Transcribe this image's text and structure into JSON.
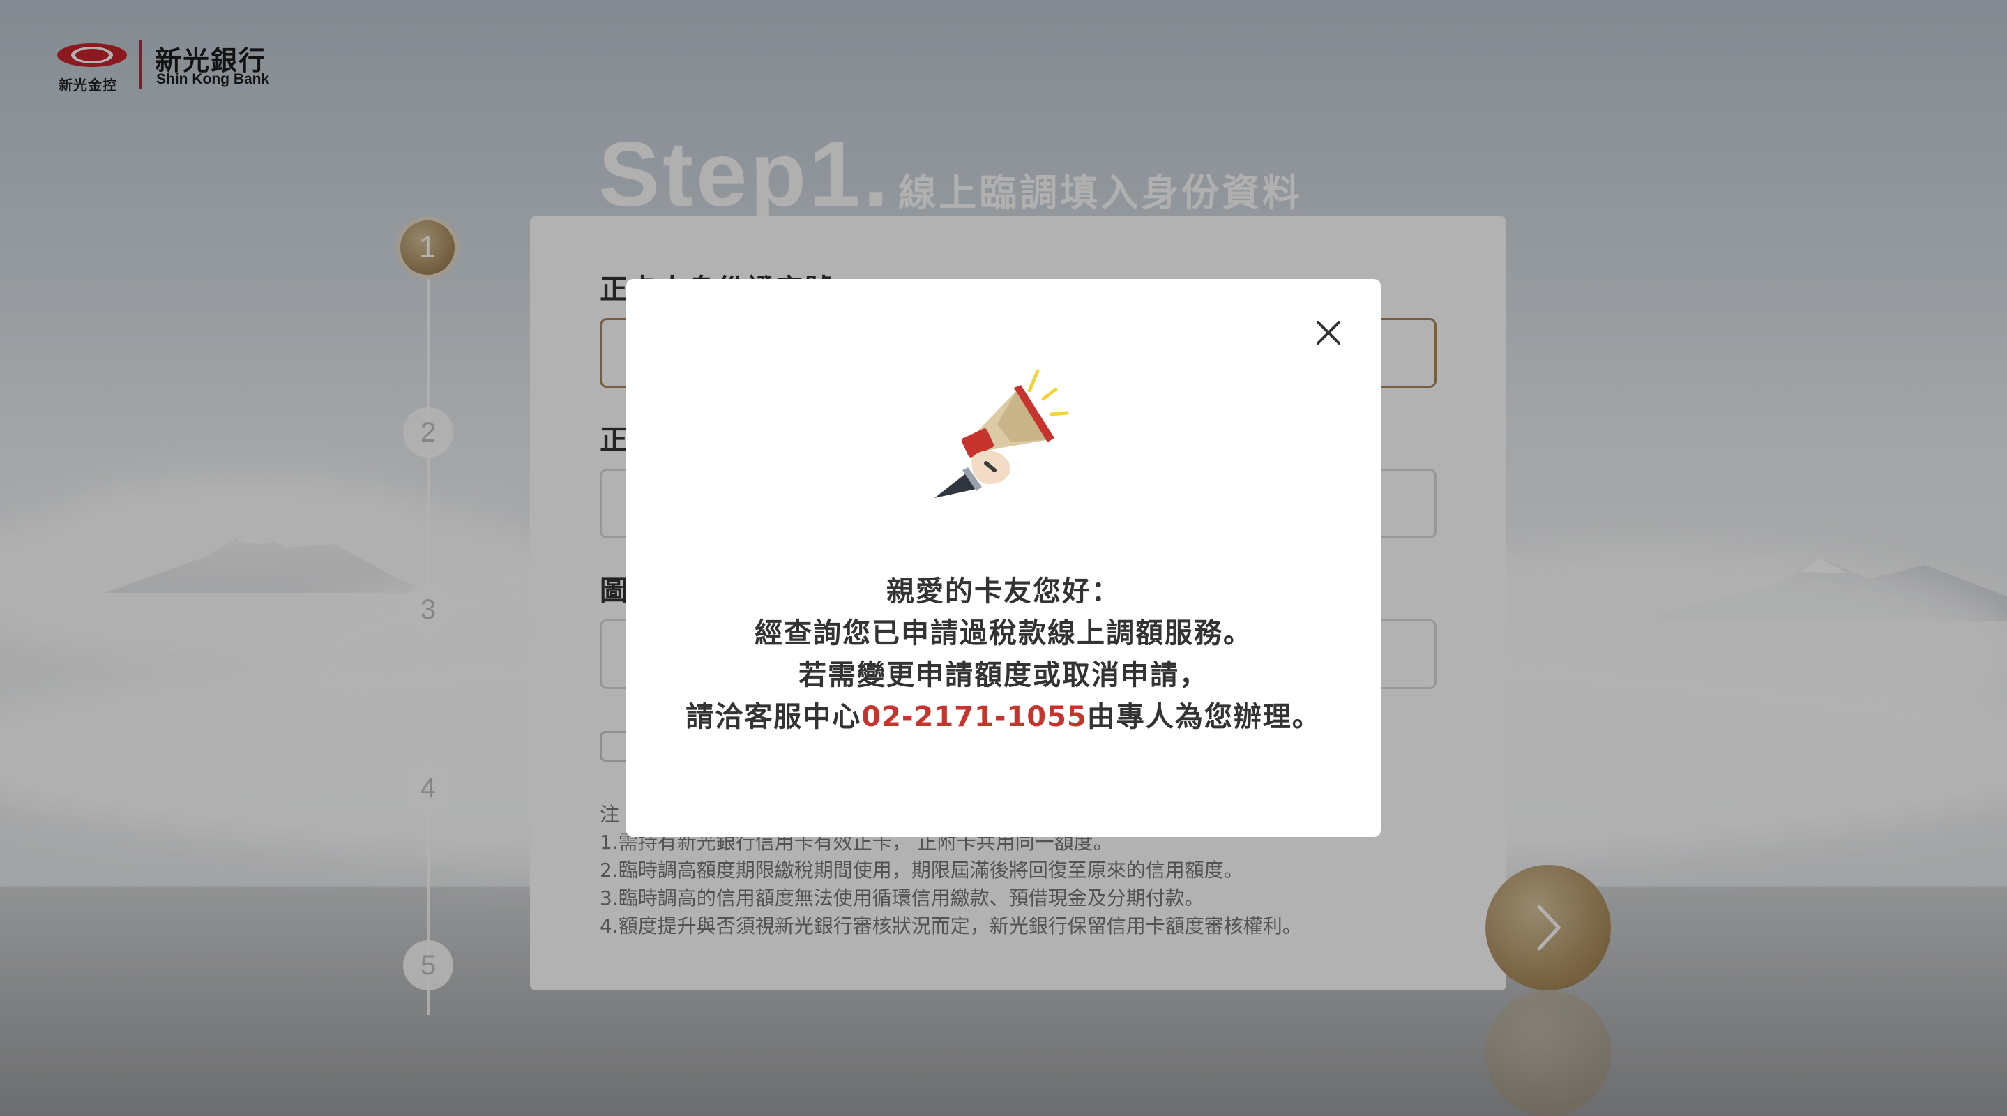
{
  "logo": {
    "emblem_char": "光",
    "group_name": "新光金控",
    "bank_name": "新光銀行",
    "bank_name_en": "Shin Kong Bank"
  },
  "step_heading": {
    "step": "Step1",
    "dot": ".",
    "subtitle": "線上臨調填入身份資料"
  },
  "stepper": {
    "steps": [
      "1",
      "2",
      "3",
      "4",
      "5"
    ],
    "active_index": 0
  },
  "form": {
    "field1_label_visible": "正卡人身份證字號",
    "field2_label_visible": "正",
    "field3_label_visible": "圖",
    "notes_prefix": "注",
    "notes": [
      "1.需持有新光銀行信用卡有效正卡， 正附卡共用同一額度。",
      "2.臨時調高額度期限繳稅期間使用，期限屆滿後將回復至原來的信用額度。",
      "3.臨時調高的信用額度無法使用循環信用繳款、預借現金及分期付款。",
      "4.額度提升與否須視新光銀行審核狀況而定，新光銀行保留信用卡額度審核權利。"
    ]
  },
  "modal": {
    "line1": "親愛的卡友您好：",
    "line2": "經查詢您已申請過稅款線上調額服務。",
    "line3": "若需變更申請額度或取消申請，",
    "line4_before": "請洽客服中心",
    "line4_phone": "02-2171-1055",
    "line4_after": "由專人為您辦理。",
    "icon": "megaphone-icon",
    "close_icon": "close-icon"
  },
  "colors": {
    "brand_red": "#c9252d",
    "gold": "#a8895c",
    "phone_red": "#c7342d"
  }
}
